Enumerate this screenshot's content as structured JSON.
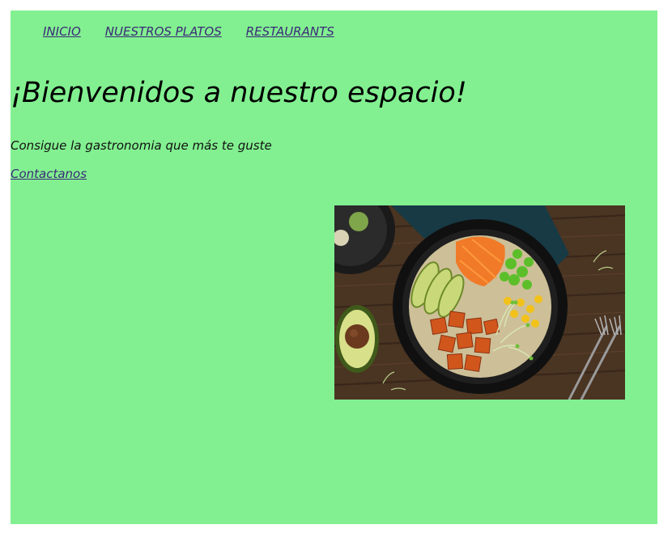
{
  "nav": {
    "items": [
      {
        "label": "INICIO"
      },
      {
        "label": "NUESTROS PLATOS"
      },
      {
        "label": "RESTAURANTS"
      }
    ]
  },
  "hero": {
    "title": "¡Bienvenidos a nuestro espacio!",
    "subtitle": "Consigue la gastronomia que más te guste",
    "contact_link": "Contactanos"
  },
  "image": {
    "description_icon": "food-bowl-photo"
  },
  "colors": {
    "background": "#82f090",
    "link": "#3a2a78"
  }
}
